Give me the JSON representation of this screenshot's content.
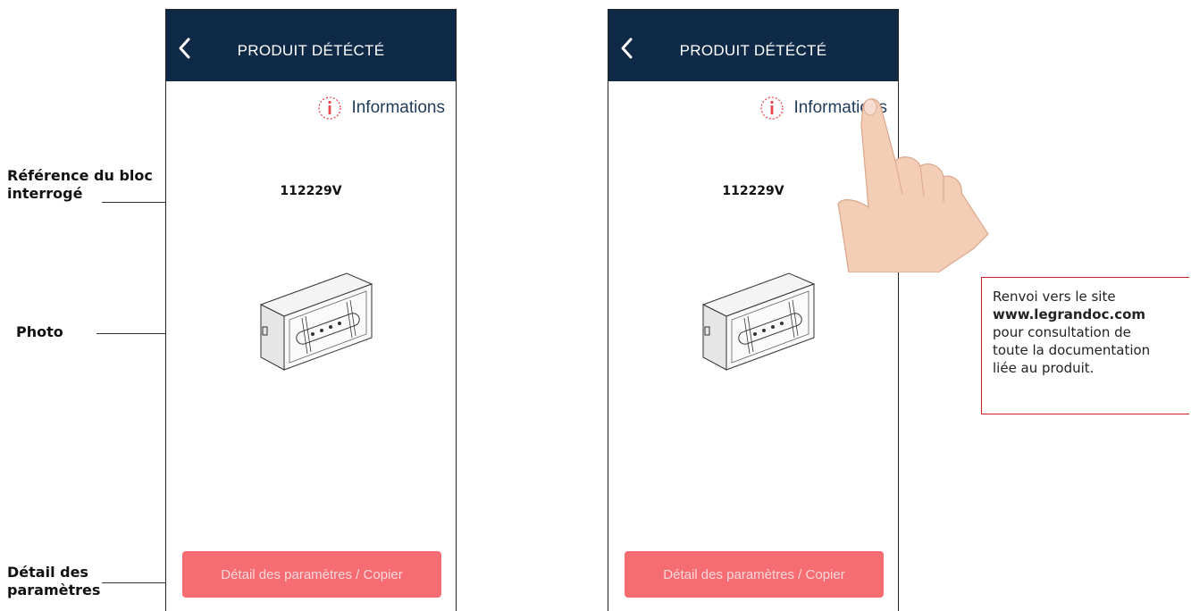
{
  "annotations": {
    "reference_line1": "Référence du bloc",
    "reference_line2": "interrogé",
    "photo": "Photo",
    "detail_line1": "Détail des",
    "detail_line2": "paramètres"
  },
  "screen": {
    "title": "PRODUIT DÉTÉCTÉ",
    "info_label": "Informations",
    "reference": "112229V",
    "detail_button": "Détail des paramètres / Copier"
  },
  "callout": {
    "line1": "Renvoi vers le site",
    "url": "www.legrandoc.com",
    "line3": "pour consultation de",
    "line4": "toute la documentation",
    "line5": "liée au produit."
  },
  "icons": {
    "back": "chevron-left-icon",
    "info": "info-icon",
    "hand": "pointing-hand-icon"
  },
  "colors": {
    "header": "#0f2a47",
    "button": "#f56d73",
    "info_accent": "#e8474d",
    "callout_border": "#d11f2a"
  }
}
